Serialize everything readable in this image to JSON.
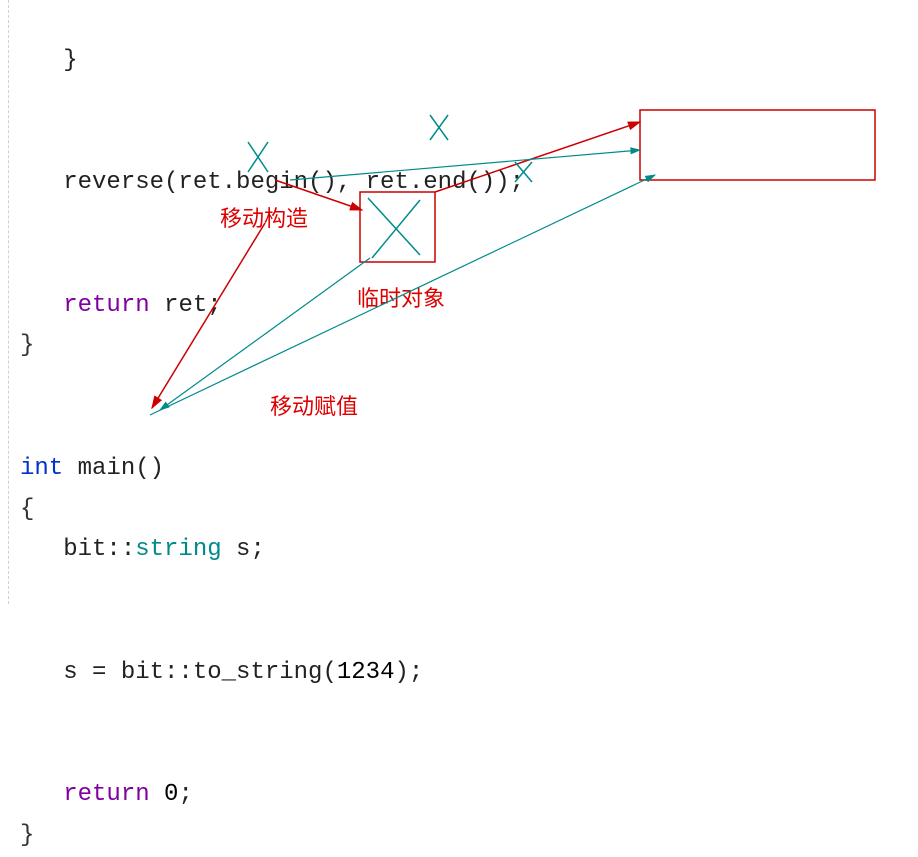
{
  "code": {
    "l0": "   }",
    "l1_a": "   reverse(ret.begin(), ",
    "l1_b": "ret.end());",
    "l2_ind": "   ",
    "l2_kw": "return",
    "l2_rest": " ret;",
    "l3": "}",
    "l4_kw": "int",
    "l4_rest": " main()",
    "l5": "{",
    "l6_a": "   bit::",
    "l6_b": "string",
    "l6_c": " s;",
    "l7_a": "   s = bit::to_string(",
    "l7_num": "1234",
    "l7_c": ");",
    "l8_ind": "   ",
    "l8_kw": "return",
    "l8_sp": " ",
    "l8_num": "0",
    "l8_end": ";",
    "l9": "}"
  },
  "annotations": {
    "move_ctor": "移动构造",
    "temp_obj": "临时对象",
    "move_assign": "移动赋值"
  },
  "colors": {
    "red": "#cc0000",
    "teal_stroke": "#008b8b"
  }
}
